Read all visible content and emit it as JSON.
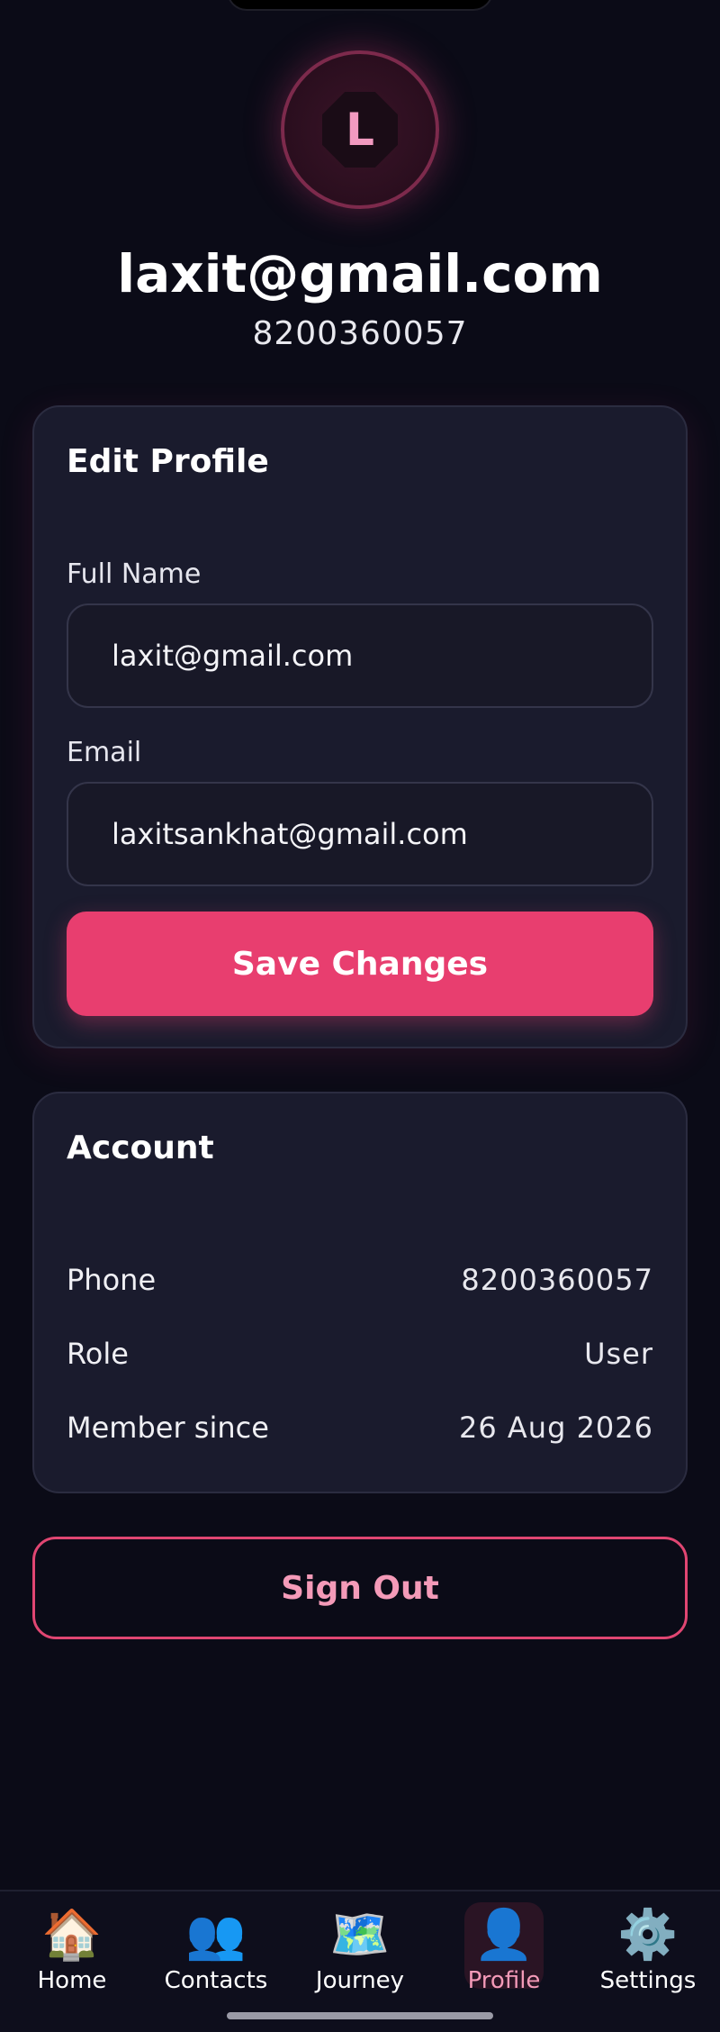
{
  "profile": {
    "avatar_initial": "L",
    "display_name": "laxit@gmail.com",
    "phone": "8200360057"
  },
  "edit_profile": {
    "title": "Edit Profile",
    "full_name_label": "Full Name",
    "full_name_value": "laxit@gmail.com",
    "email_label": "Email",
    "email_value": "laxitsankhat@gmail.com",
    "save_label": "Save Changes"
  },
  "account": {
    "title": "Account",
    "rows": [
      {
        "key": "Phone",
        "value": "8200360057"
      },
      {
        "key": "Role",
        "value": "User"
      },
      {
        "key": "Member since",
        "value": "26 Aug 2026"
      }
    ]
  },
  "sign_out_label": "Sign Out",
  "tabs": [
    {
      "label": "Home",
      "icon": "house-icon",
      "glyph": "🏠"
    },
    {
      "label": "Contacts",
      "icon": "contacts-icon",
      "glyph": "👥"
    },
    {
      "label": "Journey",
      "icon": "map-icon",
      "glyph": "🗺️"
    },
    {
      "label": "Profile",
      "icon": "profile-icon",
      "glyph": "👤"
    },
    {
      "label": "Settings",
      "icon": "gear-icon",
      "glyph": "⚙️"
    }
  ],
  "colors": {
    "background": "#0b0b17",
    "card": "#1a1b2d",
    "accent": "#e83e6f",
    "accent_text": "#f49ab8"
  }
}
